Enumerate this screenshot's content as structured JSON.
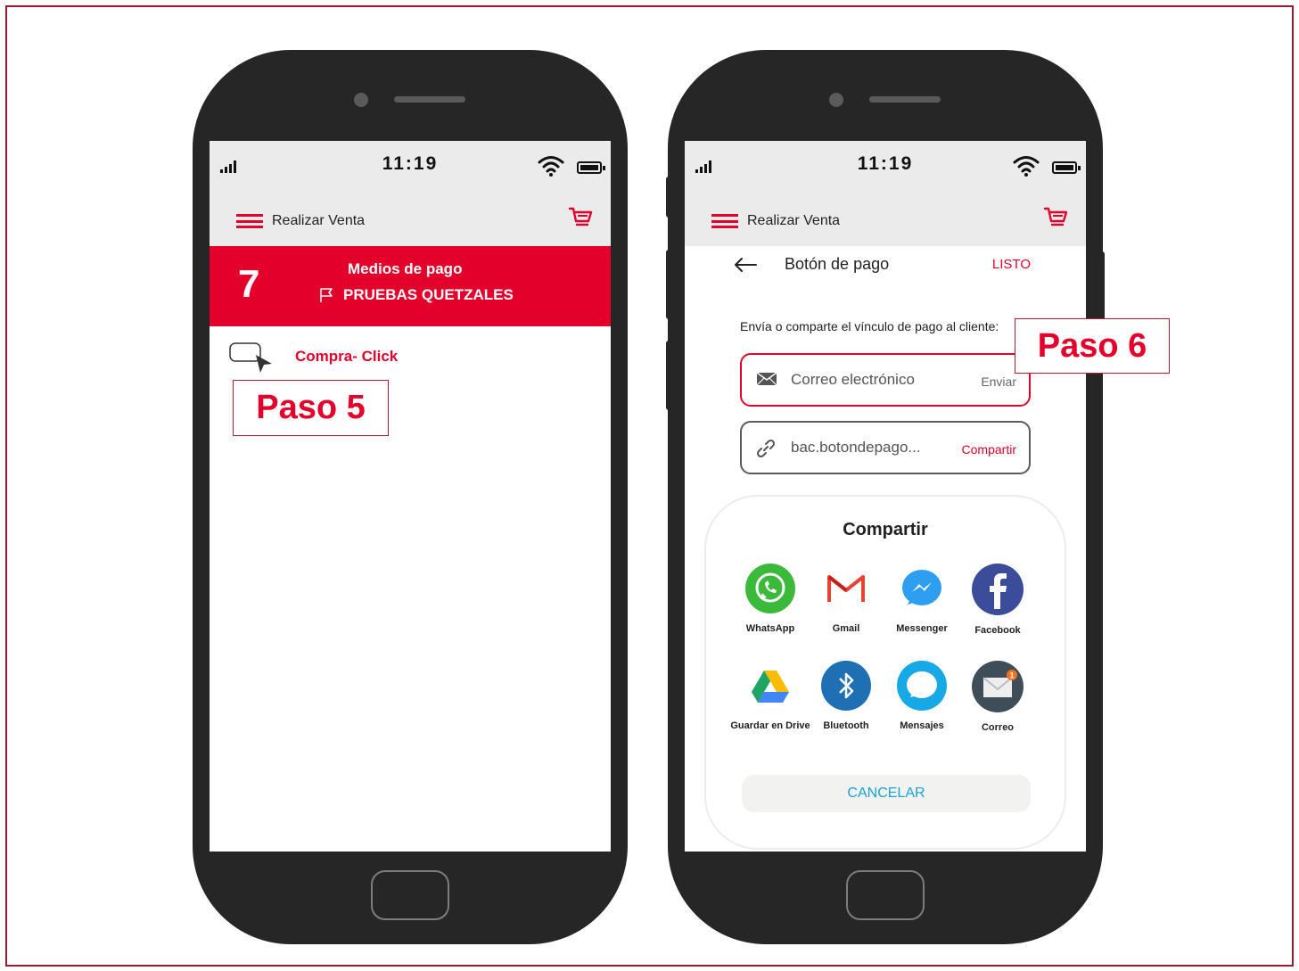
{
  "phone_left": {
    "time": "11:19",
    "appbar_title": "Realizar Venta",
    "banner": {
      "number": "7",
      "title": "Medios de pago",
      "subtitle": "PRUEBAS QUETZALES"
    },
    "item_label": "Compra- Click",
    "step_label": "Paso 5"
  },
  "phone_right": {
    "time": "11:19",
    "appbar_title": "Realizar Venta",
    "sub_title": "Botón de pago",
    "done_label": "LISTO",
    "instruction": "Envía o comparte el vínculo de pago al cliente:",
    "step_label": "Paso 6",
    "email_field": {
      "placeholder": "Correo electrónico",
      "action": "Enviar"
    },
    "link_field": {
      "value": "bac.botondepago...",
      "action": "Compartir"
    },
    "share": {
      "title": "Compartir",
      "apps": [
        {
          "label": "WhatsApp",
          "icon": "whatsapp-icon"
        },
        {
          "label": "Gmail",
          "icon": "gmail-icon"
        },
        {
          "label": "Messenger",
          "icon": "messenger-icon"
        },
        {
          "label": "Facebook",
          "icon": "facebook-icon"
        },
        {
          "label": "Guardar en Drive",
          "icon": "drive-icon"
        },
        {
          "label": "Bluetooth",
          "icon": "bluetooth-icon"
        },
        {
          "label": "Mensajes",
          "icon": "messages-icon"
        },
        {
          "label": "Correo",
          "icon": "mail-icon"
        }
      ],
      "mail_badge": "1",
      "cancel_label": "CANCELAR"
    }
  },
  "colors": {
    "brand_red": "#e3002b",
    "frame_border": "#9b1c2e",
    "phone_body": "#262626",
    "cancel_text": "#1aa3d6"
  }
}
